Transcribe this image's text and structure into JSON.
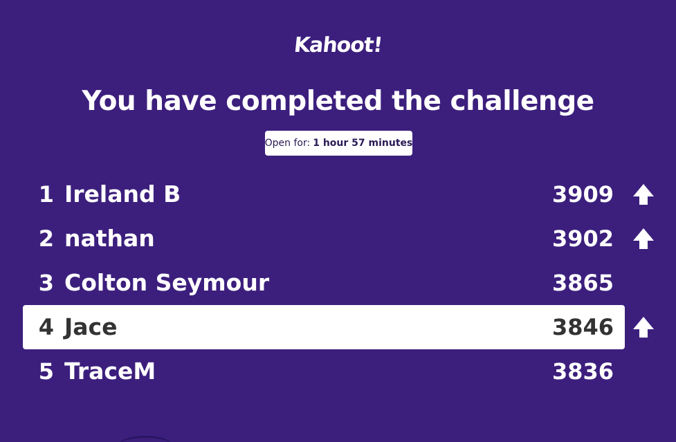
{
  "logo": {
    "text": "Kahoot!"
  },
  "title": "You have completed the challenge",
  "timer": {
    "label": "Open for:",
    "value": "1 hour 57 minutes"
  },
  "leaderboard": [
    {
      "rank": "1",
      "name": "Ireland B",
      "score": "3909",
      "trend": "up-arrow-icon",
      "highlight": false
    },
    {
      "rank": "2",
      "name": "nathan",
      "score": "3902",
      "trend": "up-arrow-icon",
      "highlight": false
    },
    {
      "rank": "3",
      "name": "Colton Seymour",
      "score": "3865",
      "trend": "",
      "highlight": false
    },
    {
      "rank": "4",
      "name": "Jace",
      "score": "3846",
      "trend": "up-arrow-icon",
      "highlight": true
    },
    {
      "rank": "5",
      "name": "TraceM",
      "score": "3836",
      "trend": "",
      "highlight": false
    }
  ],
  "colors": {
    "background": "#3c1f7d",
    "highlight": "#ffffff",
    "text": "#ffffff",
    "highlight_text": "#333333"
  }
}
